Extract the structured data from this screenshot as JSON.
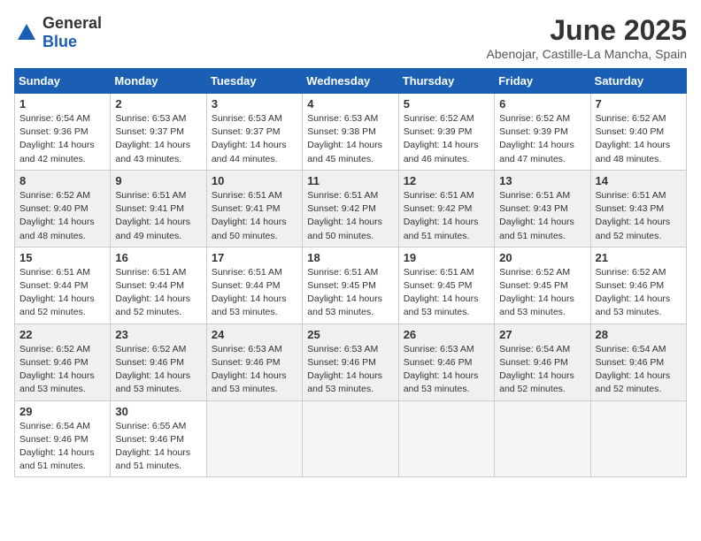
{
  "logo": {
    "general": "General",
    "blue": "Blue"
  },
  "header": {
    "title": "June 2025",
    "subtitle": "Abenojar, Castille-La Mancha, Spain"
  },
  "weekdays": [
    "Sunday",
    "Monday",
    "Tuesday",
    "Wednesday",
    "Thursday",
    "Friday",
    "Saturday"
  ],
  "weeks": [
    [
      {
        "day": "1",
        "sunrise": "Sunrise: 6:54 AM",
        "sunset": "Sunset: 9:36 PM",
        "daylight": "Daylight: 14 hours and 42 minutes."
      },
      {
        "day": "2",
        "sunrise": "Sunrise: 6:53 AM",
        "sunset": "Sunset: 9:37 PM",
        "daylight": "Daylight: 14 hours and 43 minutes."
      },
      {
        "day": "3",
        "sunrise": "Sunrise: 6:53 AM",
        "sunset": "Sunset: 9:37 PM",
        "daylight": "Daylight: 14 hours and 44 minutes."
      },
      {
        "day": "4",
        "sunrise": "Sunrise: 6:53 AM",
        "sunset": "Sunset: 9:38 PM",
        "daylight": "Daylight: 14 hours and 45 minutes."
      },
      {
        "day": "5",
        "sunrise": "Sunrise: 6:52 AM",
        "sunset": "Sunset: 9:39 PM",
        "daylight": "Daylight: 14 hours and 46 minutes."
      },
      {
        "day": "6",
        "sunrise": "Sunrise: 6:52 AM",
        "sunset": "Sunset: 9:39 PM",
        "daylight": "Daylight: 14 hours and 47 minutes."
      },
      {
        "day": "7",
        "sunrise": "Sunrise: 6:52 AM",
        "sunset": "Sunset: 9:40 PM",
        "daylight": "Daylight: 14 hours and 48 minutes."
      }
    ],
    [
      {
        "day": "8",
        "sunrise": "Sunrise: 6:52 AM",
        "sunset": "Sunset: 9:40 PM",
        "daylight": "Daylight: 14 hours and 48 minutes."
      },
      {
        "day": "9",
        "sunrise": "Sunrise: 6:51 AM",
        "sunset": "Sunset: 9:41 PM",
        "daylight": "Daylight: 14 hours and 49 minutes."
      },
      {
        "day": "10",
        "sunrise": "Sunrise: 6:51 AM",
        "sunset": "Sunset: 9:41 PM",
        "daylight": "Daylight: 14 hours and 50 minutes."
      },
      {
        "day": "11",
        "sunrise": "Sunrise: 6:51 AM",
        "sunset": "Sunset: 9:42 PM",
        "daylight": "Daylight: 14 hours and 50 minutes."
      },
      {
        "day": "12",
        "sunrise": "Sunrise: 6:51 AM",
        "sunset": "Sunset: 9:42 PM",
        "daylight": "Daylight: 14 hours and 51 minutes."
      },
      {
        "day": "13",
        "sunrise": "Sunrise: 6:51 AM",
        "sunset": "Sunset: 9:43 PM",
        "daylight": "Daylight: 14 hours and 51 minutes."
      },
      {
        "day": "14",
        "sunrise": "Sunrise: 6:51 AM",
        "sunset": "Sunset: 9:43 PM",
        "daylight": "Daylight: 14 hours and 52 minutes."
      }
    ],
    [
      {
        "day": "15",
        "sunrise": "Sunrise: 6:51 AM",
        "sunset": "Sunset: 9:44 PM",
        "daylight": "Daylight: 14 hours and 52 minutes."
      },
      {
        "day": "16",
        "sunrise": "Sunrise: 6:51 AM",
        "sunset": "Sunset: 9:44 PM",
        "daylight": "Daylight: 14 hours and 52 minutes."
      },
      {
        "day": "17",
        "sunrise": "Sunrise: 6:51 AM",
        "sunset": "Sunset: 9:44 PM",
        "daylight": "Daylight: 14 hours and 53 minutes."
      },
      {
        "day": "18",
        "sunrise": "Sunrise: 6:51 AM",
        "sunset": "Sunset: 9:45 PM",
        "daylight": "Daylight: 14 hours and 53 minutes."
      },
      {
        "day": "19",
        "sunrise": "Sunrise: 6:51 AM",
        "sunset": "Sunset: 9:45 PM",
        "daylight": "Daylight: 14 hours and 53 minutes."
      },
      {
        "day": "20",
        "sunrise": "Sunrise: 6:52 AM",
        "sunset": "Sunset: 9:45 PM",
        "daylight": "Daylight: 14 hours and 53 minutes."
      },
      {
        "day": "21",
        "sunrise": "Sunrise: 6:52 AM",
        "sunset": "Sunset: 9:46 PM",
        "daylight": "Daylight: 14 hours and 53 minutes."
      }
    ],
    [
      {
        "day": "22",
        "sunrise": "Sunrise: 6:52 AM",
        "sunset": "Sunset: 9:46 PM",
        "daylight": "Daylight: 14 hours and 53 minutes."
      },
      {
        "day": "23",
        "sunrise": "Sunrise: 6:52 AM",
        "sunset": "Sunset: 9:46 PM",
        "daylight": "Daylight: 14 hours and 53 minutes."
      },
      {
        "day": "24",
        "sunrise": "Sunrise: 6:53 AM",
        "sunset": "Sunset: 9:46 PM",
        "daylight": "Daylight: 14 hours and 53 minutes."
      },
      {
        "day": "25",
        "sunrise": "Sunrise: 6:53 AM",
        "sunset": "Sunset: 9:46 PM",
        "daylight": "Daylight: 14 hours and 53 minutes."
      },
      {
        "day": "26",
        "sunrise": "Sunrise: 6:53 AM",
        "sunset": "Sunset: 9:46 PM",
        "daylight": "Daylight: 14 hours and 53 minutes."
      },
      {
        "day": "27",
        "sunrise": "Sunrise: 6:54 AM",
        "sunset": "Sunset: 9:46 PM",
        "daylight": "Daylight: 14 hours and 52 minutes."
      },
      {
        "day": "28",
        "sunrise": "Sunrise: 6:54 AM",
        "sunset": "Sunset: 9:46 PM",
        "daylight": "Daylight: 14 hours and 52 minutes."
      }
    ],
    [
      {
        "day": "29",
        "sunrise": "Sunrise: 6:54 AM",
        "sunset": "Sunset: 9:46 PM",
        "daylight": "Daylight: 14 hours and 51 minutes."
      },
      {
        "day": "30",
        "sunrise": "Sunrise: 6:55 AM",
        "sunset": "Sunset: 9:46 PM",
        "daylight": "Daylight: 14 hours and 51 minutes."
      },
      null,
      null,
      null,
      null,
      null
    ]
  ]
}
